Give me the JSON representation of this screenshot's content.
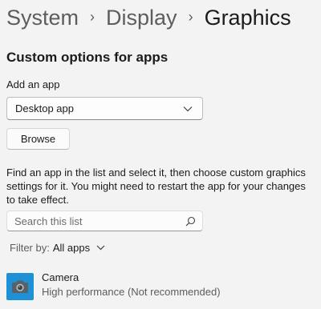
{
  "breadcrumb": {
    "items": [
      "System",
      "Display"
    ],
    "current": "Graphics",
    "separator": "›"
  },
  "section": {
    "title": "Custom options for apps"
  },
  "add_app": {
    "label": "Add an app",
    "dropdown_value": "Desktop app",
    "browse_label": "Browse"
  },
  "help_text": "Find an app in the list and select it, then choose custom graphics settings for it. You might need to restart the app for your changes to take effect.",
  "search": {
    "placeholder": "Search this list",
    "icon": "search-icon"
  },
  "filter": {
    "label": "Filter by:",
    "value": "All apps"
  },
  "apps": [
    {
      "name": "Camera",
      "setting": "High performance (Not recommended)",
      "icon": "camera-icon",
      "icon_color": "#1e90d6"
    }
  ]
}
